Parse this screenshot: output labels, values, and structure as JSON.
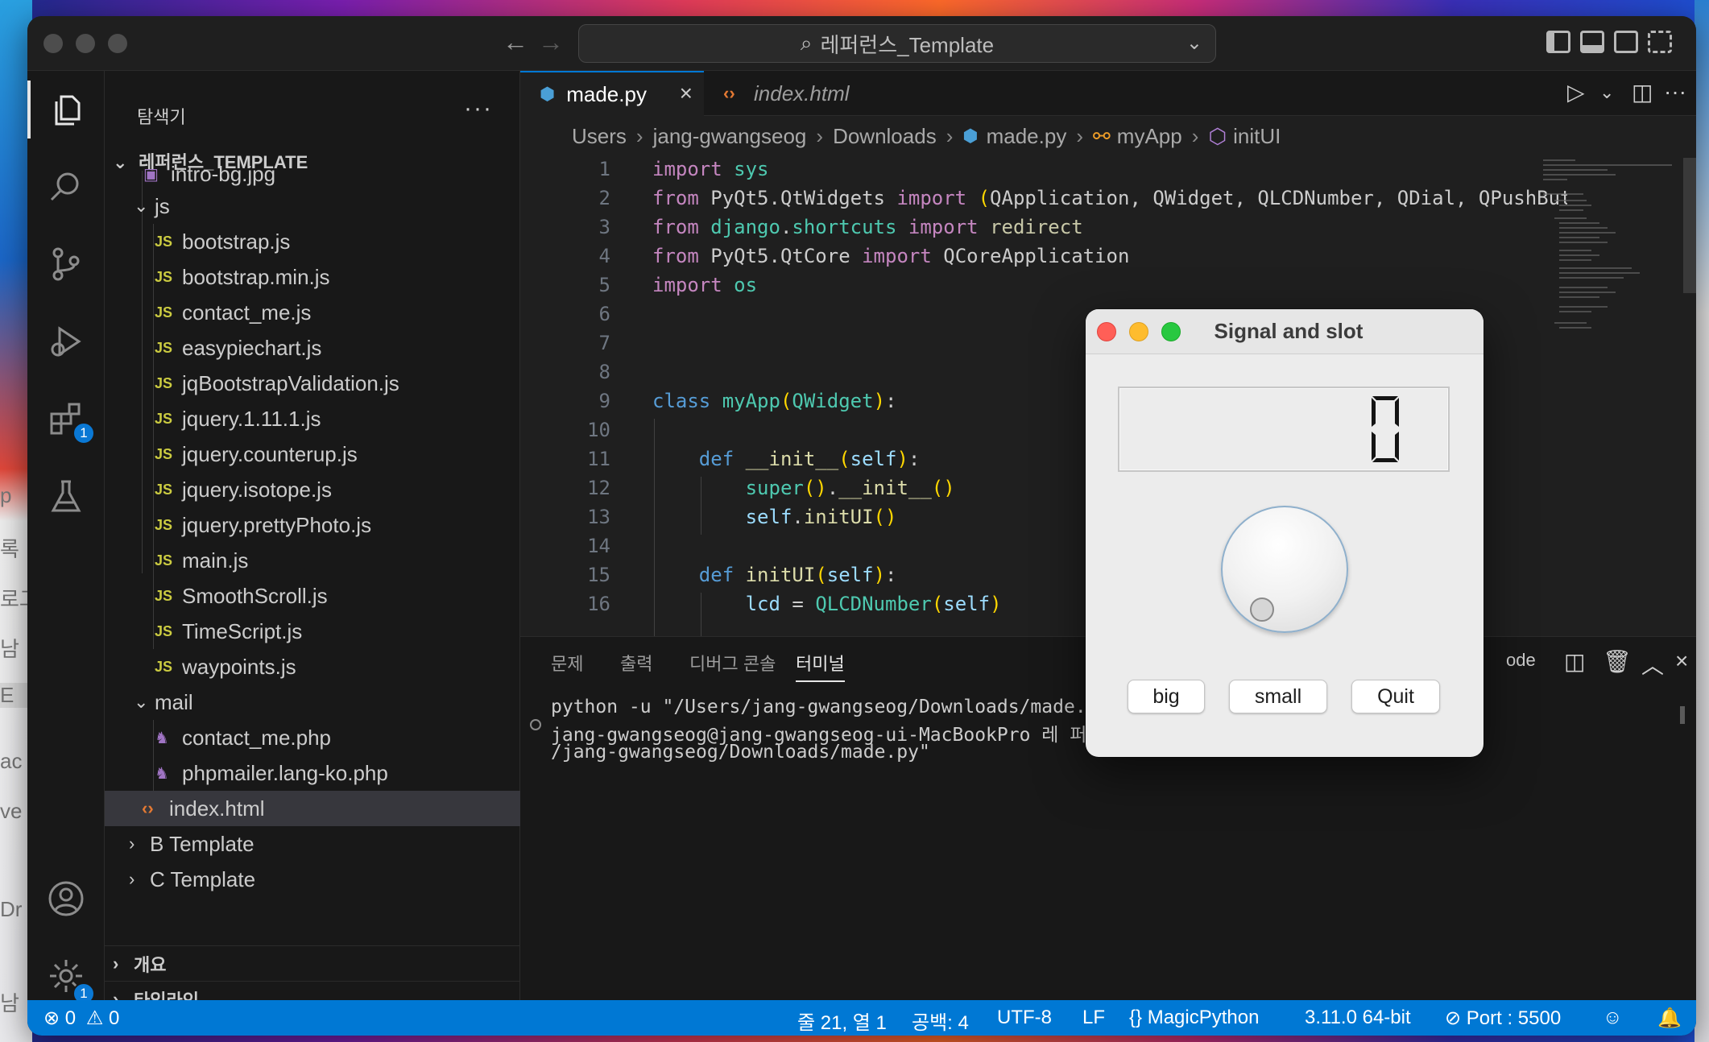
{
  "desktop": {
    "left_peek": [
      "p",
      "록",
      "로그",
      "남",
      "E",
      "ac",
      "ve C",
      "Dr",
      "남"
    ]
  },
  "titlebar": {
    "search_text": "레퍼런스_Template",
    "back_icon": "arrow-left-icon",
    "forward_icon": "arrow-right-icon"
  },
  "activitybar": {
    "extensions_badge": "1",
    "settings_badge": "1"
  },
  "sidebar": {
    "title": "탐색기",
    "more": "···",
    "section": "레퍼런스_TEMPLATE",
    "items": [
      {
        "label": "intro-bg.jpg",
        "type": "image"
      },
      {
        "label": "js",
        "type": "folder-open"
      },
      {
        "label": "bootstrap.js",
        "type": "js"
      },
      {
        "label": "bootstrap.min.js",
        "type": "js"
      },
      {
        "label": "contact_me.js",
        "type": "js"
      },
      {
        "label": "easypiechart.js",
        "type": "js"
      },
      {
        "label": "jqBootstrapValidation.js",
        "type": "js"
      },
      {
        "label": "jquery.1.11.1.js",
        "type": "js"
      },
      {
        "label": "jquery.counterup.js",
        "type": "js"
      },
      {
        "label": "jquery.isotope.js",
        "type": "js"
      },
      {
        "label": "jquery.prettyPhoto.js",
        "type": "js"
      },
      {
        "label": "main.js",
        "type": "js"
      },
      {
        "label": "SmoothScroll.js",
        "type": "js"
      },
      {
        "label": "TimeScript.js",
        "type": "js"
      },
      {
        "label": "waypoints.js",
        "type": "js"
      },
      {
        "label": "mail",
        "type": "folder-open"
      },
      {
        "label": "contact_me.php",
        "type": "php"
      },
      {
        "label": "phpmailer.lang-ko.php",
        "type": "php"
      },
      {
        "label": "index.html",
        "type": "html"
      },
      {
        "label": "B Template",
        "type": "folder-closed"
      },
      {
        "label": "C Template",
        "type": "folder-closed"
      }
    ],
    "js_badge": "JS",
    "outline": "개요",
    "timeline": "타임라인"
  },
  "tabs": [
    {
      "label": "made.py",
      "active": true
    },
    {
      "label": "index.html",
      "active": false
    }
  ],
  "breadcrumbs": [
    "Users",
    "jang-gwangseog",
    "Downloads",
    "made.py",
    "myApp",
    "initUI"
  ],
  "code": {
    "line_numbers": [
      "1",
      "2",
      "3",
      "4",
      "5",
      "6",
      "7",
      "8",
      "9",
      "10",
      "11",
      "12",
      "13",
      "14",
      "15",
      "16"
    ]
  },
  "panel": {
    "tabs": [
      "문제",
      "출력",
      "디버그 콘솔",
      "터미널"
    ],
    "code_label": "ode",
    "terminal": [
      "python -u \"/Users/jang-gwangseog/Downloads/made.",
      "jang-gwangseog@jang-gwangseog-ui-MacBookPro 레 퍼",
      "/jang-gwangseog/Downloads/made.py\""
    ]
  },
  "statusbar": {
    "errors": "0",
    "warnings": "0",
    "position": "줄 21, 열 1",
    "spaces": "공백: 4",
    "encoding": "UTF-8",
    "eol": "LF",
    "language": "MagicPython",
    "python_version": "3.11.0 64-bit",
    "port": "Port : 5500"
  },
  "qt_window": {
    "title": "Signal and slot",
    "lcd_value": "0",
    "dial_value": 0,
    "buttons": [
      "big",
      "small",
      "Quit"
    ]
  },
  "colors": {
    "accent": "#0078d4",
    "statusbar": "#0078d4",
    "js": "#cbcb41"
  }
}
